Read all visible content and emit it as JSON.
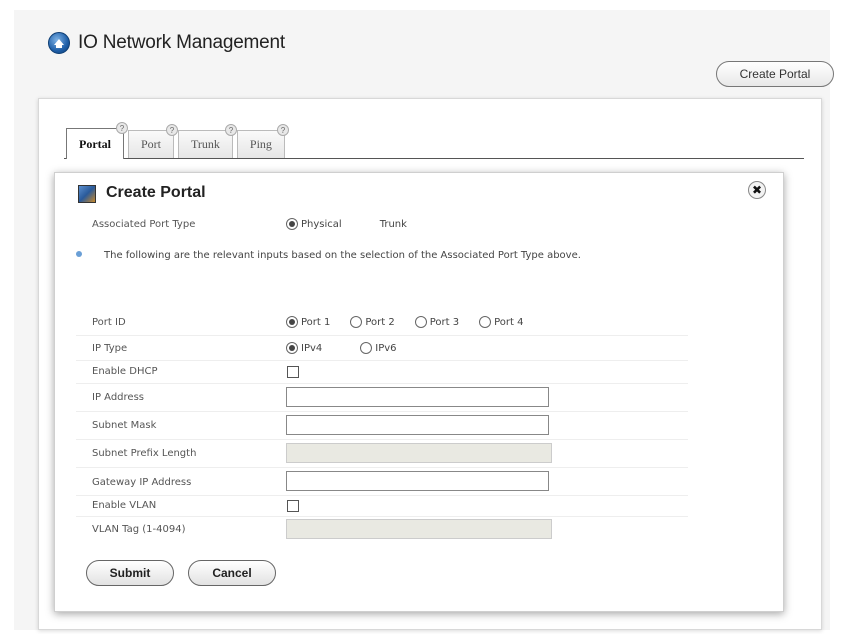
{
  "header": {
    "title": "IO Network Management",
    "create_portal_label": "Create Portal"
  },
  "tabs": [
    {
      "label": "Portal",
      "help": "?",
      "active": true
    },
    {
      "label": "Port",
      "help": "?",
      "active": false
    },
    {
      "label": "Trunk",
      "help": "?",
      "active": false
    },
    {
      "label": "Ping",
      "help": "?",
      "active": false
    }
  ],
  "dialog": {
    "title": "Create Portal",
    "close": "✖",
    "associated_port_type": {
      "label": "Associated Port Type",
      "options": [
        "Physical",
        "Trunk"
      ],
      "selected": "Physical"
    },
    "info_text": "The following are the relevant inputs based on the selection of the Associated Port Type above.",
    "port_id": {
      "label": "Port ID",
      "options": [
        "Port 1",
        "Port 2",
        "Port 3",
        "Port 4"
      ],
      "selected": "Port 1"
    },
    "ip_type": {
      "label": "IP Type",
      "options": [
        "IPv4",
        "IPv6"
      ],
      "selected": "IPv4"
    },
    "enable_dhcp": {
      "label": "Enable DHCP",
      "checked": false
    },
    "ip_address": {
      "label": "IP Address",
      "value": ""
    },
    "subnet_mask": {
      "label": "Subnet Mask",
      "value": ""
    },
    "subnet_prefix_length": {
      "label": "Subnet Prefix Length",
      "value": "",
      "disabled": true
    },
    "gateway_ip": {
      "label": "Gateway IP Address",
      "value": ""
    },
    "enable_vlan": {
      "label": "Enable VLAN",
      "checked": false
    },
    "vlan_tag": {
      "label": "VLAN Tag (1-4094)",
      "value": "",
      "disabled": true
    },
    "submit_label": "Submit",
    "cancel_label": "Cancel"
  }
}
